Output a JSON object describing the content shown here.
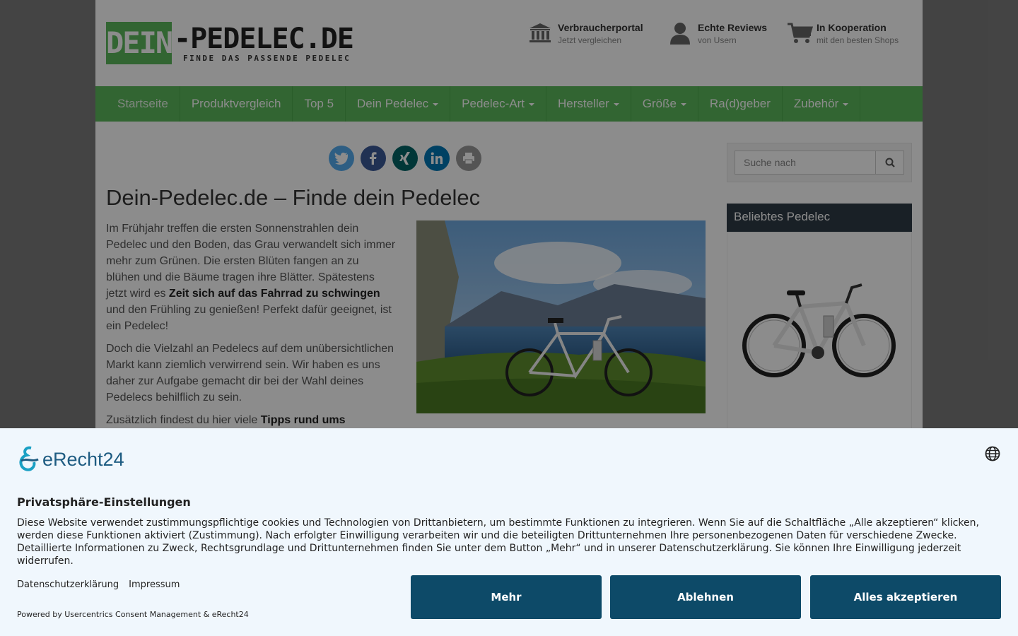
{
  "header": {
    "logo": {
      "part1": "DEIN",
      "part2": "-PEDELEC.DE",
      "tagline": "FINDE DAS PASSENDE PEDELEC"
    },
    "usps": [
      {
        "icon": "bank-icon",
        "title": "Verbraucherportal",
        "subtitle": "Jetzt vergleichen"
      },
      {
        "icon": "user-icon",
        "title": "Echte Reviews",
        "subtitle": "von Usern"
      },
      {
        "icon": "cart-icon",
        "title": "In Kooperation",
        "subtitle": "mit den besten Shops"
      }
    ]
  },
  "nav": {
    "items": [
      {
        "label": "Startseite",
        "dropdown": false
      },
      {
        "label": "Produktvergleich",
        "dropdown": false
      },
      {
        "label": "Top 5",
        "dropdown": false
      },
      {
        "label": "Dein Pedelec",
        "dropdown": true
      },
      {
        "label": "Pedelec-Art",
        "dropdown": true
      },
      {
        "label": "Hersteller",
        "dropdown": true
      },
      {
        "label": "Größe",
        "dropdown": true
      },
      {
        "label": "Ra(d)geber",
        "dropdown": false
      },
      {
        "label": "Zubehör",
        "dropdown": true
      }
    ]
  },
  "social": {
    "buttons": [
      {
        "icon": "twitter-icon",
        "color": "#55acee"
      },
      {
        "icon": "facebook-icon",
        "color": "#3b5998"
      },
      {
        "icon": "xing-icon",
        "color": "#026466"
      },
      {
        "icon": "linkedin-icon",
        "color": "#0077b5"
      },
      {
        "icon": "print-icon",
        "color": "#999999"
      }
    ]
  },
  "main": {
    "title": "Dein-Pedelec.de – Finde dein Pedelec",
    "p1_a": "Im Frühjahr treffen die ersten Sonnenstrahlen dein Pedelec und den Boden, das Grau verwandelt sich immer mehr zum Grünen. Die ersten Blüten fangen an zu blühen und die Bäume tragen ihre Blätter. Spätestens jetzt wird es ",
    "p1_b": "Zeit sich auf das Fahrrad zu schwingen",
    "p1_c": " und den Frühling zu genießen! Perfekt dafür geeignet, ist ein Pedelec!",
    "p2": "Doch die Vielzahl an Pedelecs auf dem unübersichtlichen Markt kann ziemlich verwirrend sein. Wir haben es uns daher zur Aufgabe gemacht dir bei der Wahl deines Pedelecs behilflich zu sein.",
    "p3_a": "Zusätzlich findest du hier viele ",
    "p3_b": "Tipps rund ums"
  },
  "sidebar": {
    "search_placeholder": "Suche nach",
    "widget_title": "Beliebtes Pedelec"
  },
  "consent": {
    "brand": "eRecht24",
    "title": "Privatsphäre-Einstellungen",
    "text": "Diese Website verwendet zustimmungspflichtige cookies und Technologien von Drittanbietern, um bestimmte Funktionen zu integrieren. Wenn Sie auf die Schaltfläche „Alle akzeptieren“ klicken, werden diese Funktionen aktiviert (Zustimmung). Nach erfolgter Einwilligung verarbeiten wir und die beteiligten Drittunternehmen Ihre personenbezogenen Daten für verschiedene Zwecke. Detaillierte Informationen zu Zweck, Rechtsgrundlage und Drittunternehmen finden Sie unter dem Button „Mehr“ und in unserer Datenschutzerklärung. Sie können Ihre Einwilligung jederzeit widerrufen.",
    "link_privacy": "Datenschutzerklärung",
    "link_imprint": "Impressum",
    "powered": "Powered by Usercentrics Consent Management & eRecht24",
    "btn_more": "Mehr",
    "btn_decline": "Ablehnen",
    "btn_accept": "Alles akzeptieren"
  }
}
